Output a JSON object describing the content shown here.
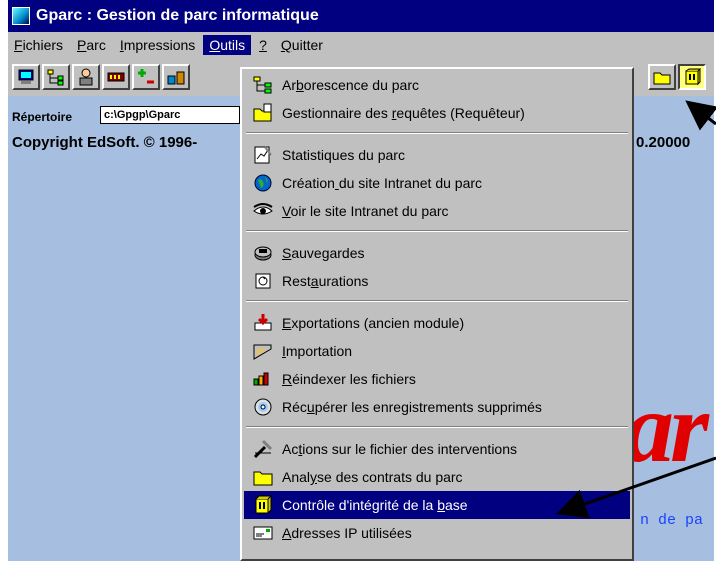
{
  "window": {
    "title": "Gparc : Gestion de parc informatique"
  },
  "menubar": {
    "items": [
      {
        "label": "Fichiers",
        "key": "F",
        "rest": "ichiers"
      },
      {
        "label": "Parc",
        "key": "P",
        "rest": "arc"
      },
      {
        "label": "Impressions",
        "key": "I",
        "rest": "mpressions"
      },
      {
        "label": "Outils",
        "key": "O",
        "rest": "utils",
        "active": true
      },
      {
        "label": "?",
        "key": "?",
        "rest": ""
      },
      {
        "label": "Quitter",
        "key": "Q",
        "rest": "uitter"
      }
    ]
  },
  "toolbar": {
    "buttons": [
      "computer-icon",
      "tree-icon",
      "user-icon",
      "network-card-icon",
      "add-remove-icon",
      "devices-icon",
      "folder-icon",
      "database-icon"
    ]
  },
  "workspace": {
    "dir_label": "Répertoire",
    "dir_value": "c:\\Gpgp\\Gparc",
    "copyright": "Copyright EdSoft. © 1996-",
    "version": "0.20000",
    "big_text": "ar",
    "blue_text": "n de pa"
  },
  "outils_menu": {
    "items": [
      {
        "pre": "Ar",
        "u": "b",
        "post": "orescence du parc",
        "icon": "tree-icon"
      },
      {
        "pre": "Gestionnaire des ",
        "u": "r",
        "post": "equêtes (Requêteur)",
        "icon": "query-folder-icon"
      },
      {
        "pre": "",
        "u": "",
        "post": "Statistiques du parc",
        "icon": "statistics-icon"
      },
      {
        "pre": "Création",
        "u": " ",
        "post": "du site Intranet du parc",
        "icon": "globe-icon"
      },
      {
        "pre": "",
        "u": "V",
        "post": "oir le site Intranet du parc",
        "icon": "eye-icon"
      },
      {
        "pre": "",
        "u": "S",
        "post": "auvegardes",
        "icon": "backup-icon"
      },
      {
        "pre": "Rest",
        "u": "a",
        "post": "urations",
        "icon": "restore-icon"
      },
      {
        "pre": "",
        "u": "E",
        "post": "xportations (ancien module)",
        "icon": "export-icon"
      },
      {
        "pre": "",
        "u": "I",
        "post": "mportation",
        "icon": "import-icon"
      },
      {
        "pre": "",
        "u": "R",
        "post": "éindexer les fichiers",
        "icon": "reindex-icon"
      },
      {
        "pre": "Réc",
        "u": "u",
        "post": "pérer les enregistrements supprimés",
        "icon": "cd-icon"
      },
      {
        "pre": "Ac",
        "u": "t",
        "post": "ions sur le fichier des interventions",
        "icon": "tools-icon"
      },
      {
        "pre": "Anal",
        "u": "y",
        "post": "se des contrats du parc",
        "icon": "folder-icon"
      },
      {
        "pre": "Contrôle d'intégrité de la ",
        "u": "b",
        "post": "ase",
        "icon": "database-icon",
        "selected": true
      },
      {
        "pre": "",
        "u": "A",
        "post": "dresses IP utilisées",
        "icon": "ip-card-icon"
      }
    ]
  }
}
